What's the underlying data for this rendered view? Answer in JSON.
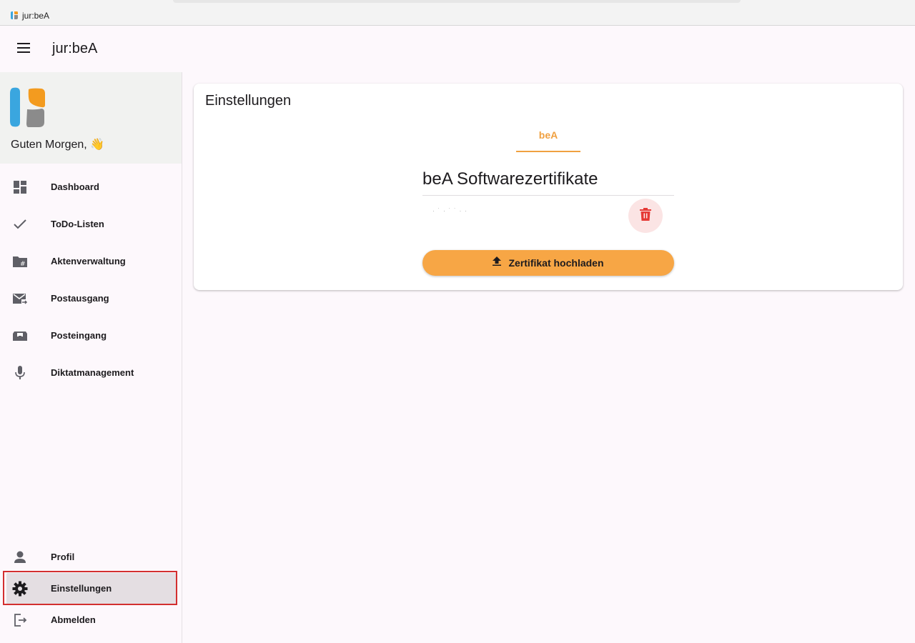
{
  "browser": {
    "tab_title": "jur:beA"
  },
  "appbar": {
    "title": "jur:beA",
    "menu_icon": "menu-icon"
  },
  "sidebar": {
    "greeting": "Guten Morgen,",
    "greeting_emoji": "👋",
    "items": [
      {
        "label": "Dashboard",
        "icon": "dashboard-icon"
      },
      {
        "label": "ToDo-Listen",
        "icon": "check-icon"
      },
      {
        "label": "Aktenverwaltung",
        "icon": "folder-hash-icon"
      },
      {
        "label": "Postausgang",
        "icon": "outbox-mail-icon"
      },
      {
        "label": "Posteingang",
        "icon": "inbox-icon"
      },
      {
        "label": "Diktatmanagement",
        "icon": "microphone-icon"
      }
    ],
    "bottom_items": [
      {
        "label": "Profil",
        "icon": "person-icon"
      },
      {
        "label": "Einstellungen",
        "icon": "gear-icon",
        "active": true
      },
      {
        "label": "Abmelden",
        "icon": "logout-icon"
      }
    ]
  },
  "settings": {
    "title": "Einstellungen",
    "tabs": [
      {
        "label": "beA",
        "active": true
      }
    ],
    "section_title": "beA Softwarezertifikate",
    "upload_label": "Zertifikat hochladen"
  },
  "colors": {
    "accent": "#f7a645",
    "tab_accent": "#f0a040",
    "delete": "#e53935",
    "highlight": "#d32f2f",
    "logo_blue": "#3aa6df",
    "logo_orange": "#f39b1f",
    "logo_gray": "#8b8b8b"
  }
}
